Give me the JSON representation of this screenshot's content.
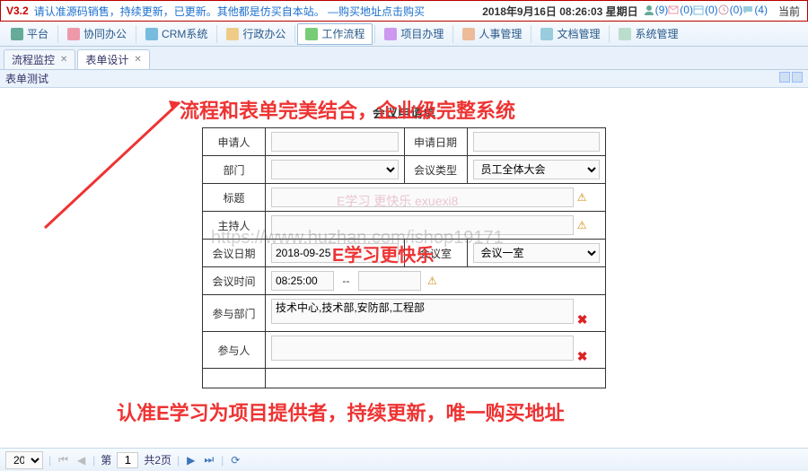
{
  "top": {
    "version": "V3.2",
    "note": "请认准源码销售，持续更新，已更新。其他都是仿买自本站。  —购买地址点击购买",
    "datetime": "2018年9月16日 08:26:03 星期日",
    "stats": [
      {
        "icon": "user",
        "n": "(9)"
      },
      {
        "icon": "mail",
        "n": "(0)"
      },
      {
        "icon": "cal",
        "n": "(0)"
      },
      {
        "icon": "clock",
        "n": "(0)"
      },
      {
        "icon": "chat",
        "n": "(4)"
      }
    ],
    "curuser": "当前"
  },
  "menu": [
    {
      "label": "平台"
    },
    {
      "label": "协同办公"
    },
    {
      "label": "CRM系统"
    },
    {
      "label": "行政办公"
    },
    {
      "label": "工作流程",
      "active": true
    },
    {
      "label": "项目办理"
    },
    {
      "label": "人事管理"
    },
    {
      "label": "文档管理"
    },
    {
      "label": "系统管理"
    }
  ],
  "tabs": [
    {
      "label": "流程监控"
    },
    {
      "label": "表单设计",
      "active": true
    }
  ],
  "subheader": "表单测试",
  "annotations": {
    "a1": "流程和表单完美结合，企业级完整系统",
    "a2": "E学习更快乐",
    "a3": "认准E学习为项目提供者，持续更新，唯一购买地址",
    "wm1": "E学习 更快乐 exuexi8",
    "wm2": "https://www.huzhan.com/ishop19171"
  },
  "form": {
    "title": "会议申请单",
    "labels": {
      "applicant": "申请人",
      "applyDate": "申请日期",
      "dept": "部门",
      "meetType": "会议类型",
      "subject": "标题",
      "host": "主持人",
      "meetDate": "会议日期",
      "room": "会议室",
      "meetTime": "会议时间",
      "joinDept": "参与部门",
      "joinPerson": "参与人"
    },
    "values": {
      "applicant": "",
      "applyDate": "",
      "dept": "",
      "meetType": "员工全体大会",
      "subject": "",
      "host": "",
      "meetDate": "2018-09-25",
      "room": "会议一室",
      "timeFrom": "08:25:00",
      "timeTo": "",
      "joinDept": "技术中心,技术部,安防部,工程部",
      "joinPerson": ""
    }
  },
  "pager": {
    "pageSize": "20",
    "prefix": "第",
    "page": "1",
    "total": "共2页"
  }
}
